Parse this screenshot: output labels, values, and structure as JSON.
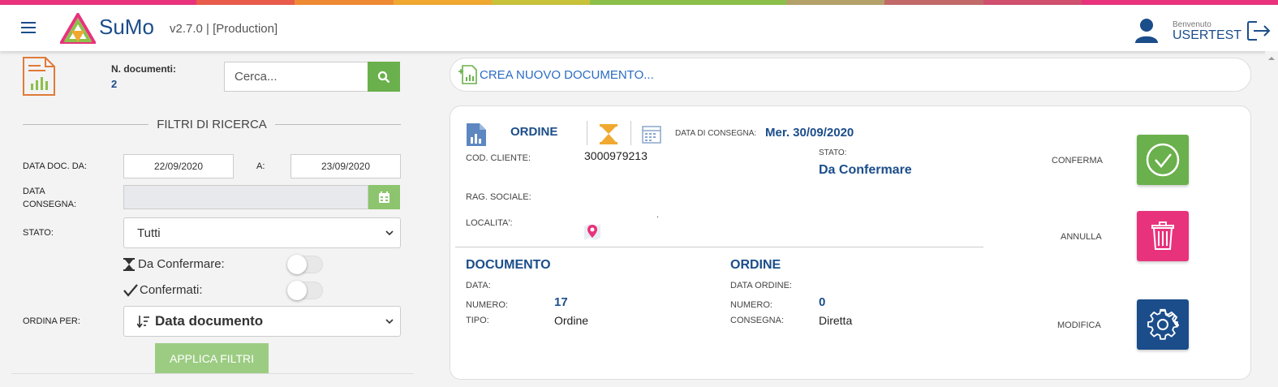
{
  "app": {
    "name": "SuMo",
    "version": "v2.7.0 | [Production]"
  },
  "colors": {
    "primary": "#1b4d8a",
    "green": "#6ab04c",
    "pink": "#e8327c",
    "rainbow": [
      "#e8327c",
      "#e8327c",
      "#e95b4a",
      "#ef8a34",
      "#f0a830",
      "#c8c23a",
      "#8cc04a",
      "#8cc04a",
      "#b4a16a",
      "#c26a6a",
      "#d0506e",
      "#e8327c",
      "#e8327c"
    ]
  },
  "user": {
    "welcome": "Benvenuto",
    "name": "USERTEST"
  },
  "left": {
    "ndoc_label": "N. documenti:",
    "ndoc_value": "2",
    "search_placeholder": "Cerca...",
    "filters_title": "FILTRI DI RICERCA",
    "date_from_label": "DATA DOC. DA:",
    "date_from": "22/09/2020",
    "date_to_label": "A:",
    "date_to": "23/09/2020",
    "delivery_label_1": "DATA",
    "delivery_label_2": "CONSEGNA:",
    "stato_label": "STATO:",
    "stato_value": "Tutti",
    "chk_da_confermare": "Da Confermare:",
    "chk_confermati": "Confermati:",
    "ordina_label": "ORDINA PER:",
    "ordina_value": "Data documento",
    "apply": "APPLICA FILTRI"
  },
  "create_label": "CREA NUOVO DOCUMENTO...",
  "order": {
    "type": "ORDINE",
    "delivery_label": "DATA DI CONSEGNA:",
    "delivery_value": "Mer. 30/09/2020",
    "cod_cliente_label": "COD. CLIENTE:",
    "cod_cliente_value": "3000979213",
    "stato_label": "STATO:",
    "stato_value": "Da Confermare",
    "rag_sociale_label": "RAG. SOCIALE:",
    "localita_label": "LOCALITA':",
    "localita_value": ".",
    "doc_title": "DOCUMENTO",
    "data_label": "DATA:",
    "numero_label": "NUMERO:",
    "numero_value": "17",
    "tipo_label": "TIPO:",
    "tipo_value": "Ordine",
    "ordine_title": "ORDINE",
    "data_ordine_label": "DATA ORDINE:",
    "ordine_numero_label": "NUMERO:",
    "ordine_numero_value": "0",
    "consegna_label": "CONSEGNA:",
    "consegna_value": "Diretta",
    "confirm_label": "CONFERMA",
    "cancel_label": "ANNULLA",
    "modify_label": "MODIFICA"
  }
}
